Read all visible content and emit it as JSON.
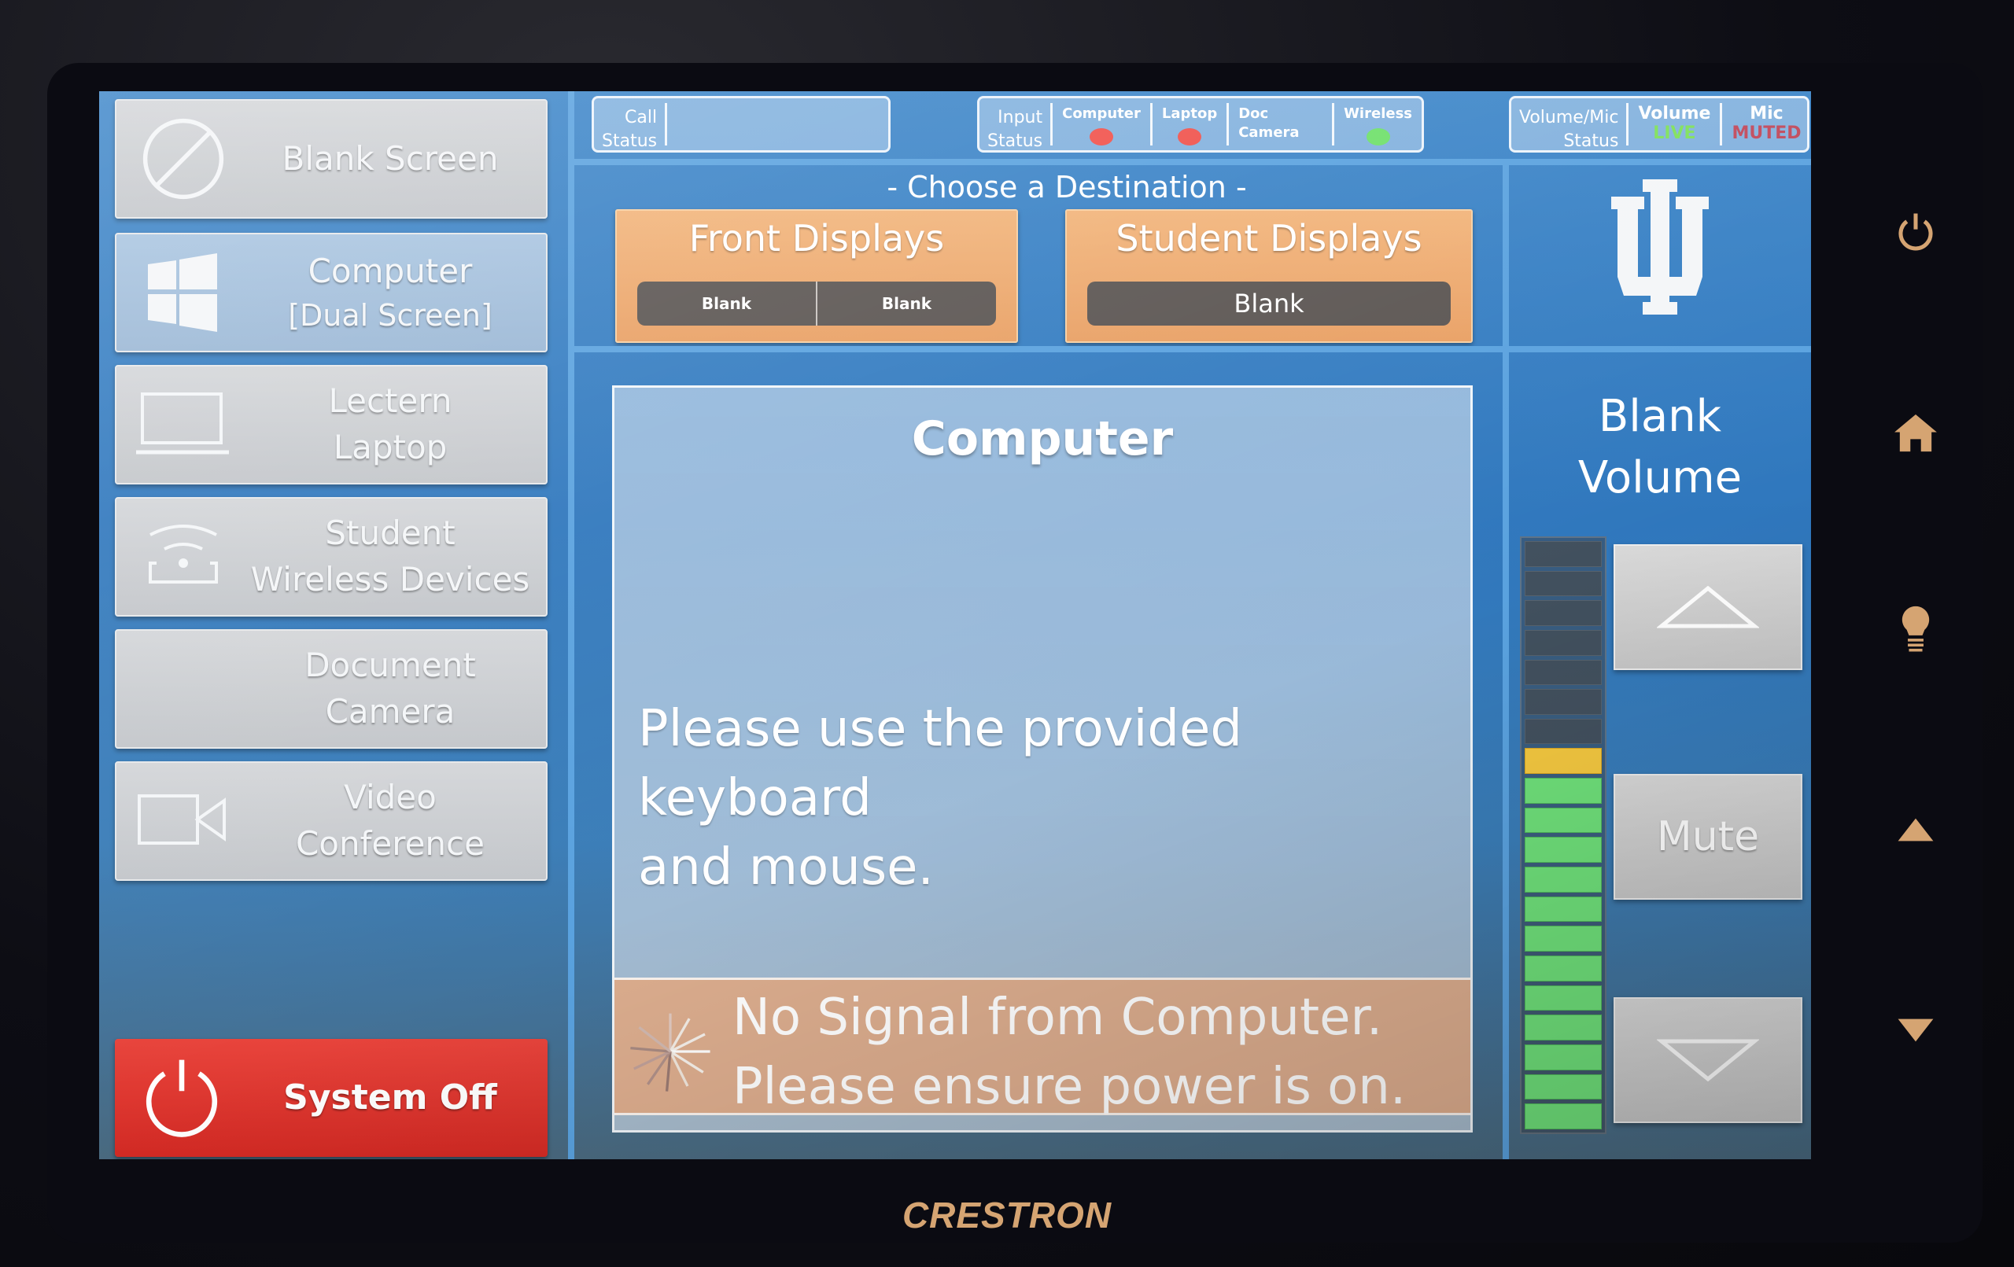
{
  "device": {
    "brand": "CRESTRON"
  },
  "sources": [
    {
      "label": "Blank Screen",
      "icon": "blank-circle-icon",
      "active": false
    },
    {
      "label": "Computer\n[Dual Screen]",
      "line1": "Computer",
      "line2": "[Dual Screen]",
      "icon": "windows-icon",
      "active": true
    },
    {
      "label": "Lectern Laptop",
      "line1": "Lectern",
      "line2": "Laptop",
      "icon": "laptop-icon",
      "active": false
    },
    {
      "label": "Student Wireless Devices",
      "line1": "Student",
      "line2": "Wireless Devices",
      "icon": "wireless-icon",
      "active": false
    },
    {
      "label": "Document Camera",
      "line1": "Document",
      "line2": "Camera",
      "icon": "none",
      "active": false
    },
    {
      "label": "Video Conference",
      "line1": "Video",
      "line2": "Conference",
      "icon": "video-camera-icon",
      "active": false
    }
  ],
  "system_off": {
    "label": "System Off",
    "icon": "power-icon"
  },
  "call_status": {
    "caption_line1": "Call",
    "caption_line2": "Status",
    "value": ""
  },
  "input_status": {
    "caption_line1": "Input",
    "caption_line2": "Status",
    "inputs": [
      {
        "label": "Computer",
        "state": "no-signal",
        "color": "#f0504a"
      },
      {
        "label": "Laptop",
        "state": "no-signal",
        "color": "#f0504a"
      },
      {
        "label": "Doc Camera",
        "state": "ok",
        "color": "#6ee06a"
      },
      {
        "label": "Wireless",
        "state": "ok",
        "color": "#6ee06a"
      }
    ]
  },
  "volume_mic_status": {
    "caption_line1": "Volume/Mic",
    "caption_line2": "Status",
    "volume": {
      "label": "Volume",
      "value": "LIVE",
      "color": "#7ee05a"
    },
    "mic": {
      "label": "Mic",
      "value": "MUTED",
      "color": "#c0485a"
    }
  },
  "destination": {
    "title": "- Choose a Destination -",
    "targets": [
      {
        "label": "Front Displays",
        "blank_buttons": [
          "Blank",
          "Blank"
        ]
      },
      {
        "label": "Student Displays",
        "blank_buttons": [
          "Blank"
        ]
      }
    ]
  },
  "main_panel": {
    "title": "Computer",
    "message_line1": "Please use the provided keyboard",
    "message_line2": "and mouse.",
    "signal_line1": "No Signal from Computer.",
    "signal_line2": "Please ensure power is on."
  },
  "logo": {
    "name": "IU trident"
  },
  "volume": {
    "blank_label_line1": "Blank",
    "blank_label_line2": "Volume",
    "mute_label": "Mute",
    "up_icon": "triangle-up-icon",
    "down_icon": "triangle-down-icon",
    "meter_segments_total": 20,
    "meter_segments_lit": 13,
    "level_fraction": 0.65
  },
  "hardware_buttons": [
    "power-icon",
    "home-icon",
    "lightbulb-icon",
    "arrow-up-icon",
    "arrow-down-icon"
  ]
}
